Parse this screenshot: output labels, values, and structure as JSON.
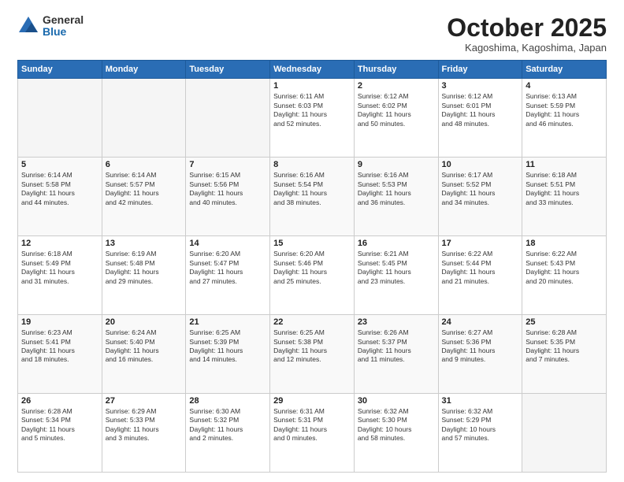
{
  "logo": {
    "general": "General",
    "blue": "Blue"
  },
  "header": {
    "month": "October 2025",
    "location": "Kagoshima, Kagoshima, Japan"
  },
  "weekdays": [
    "Sunday",
    "Monday",
    "Tuesday",
    "Wednesday",
    "Thursday",
    "Friday",
    "Saturday"
  ],
  "weeks": [
    [
      {
        "day": "",
        "info": ""
      },
      {
        "day": "",
        "info": ""
      },
      {
        "day": "",
        "info": ""
      },
      {
        "day": "1",
        "info": "Sunrise: 6:11 AM\nSunset: 6:03 PM\nDaylight: 11 hours\nand 52 minutes."
      },
      {
        "day": "2",
        "info": "Sunrise: 6:12 AM\nSunset: 6:02 PM\nDaylight: 11 hours\nand 50 minutes."
      },
      {
        "day": "3",
        "info": "Sunrise: 6:12 AM\nSunset: 6:01 PM\nDaylight: 11 hours\nand 48 minutes."
      },
      {
        "day": "4",
        "info": "Sunrise: 6:13 AM\nSunset: 5:59 PM\nDaylight: 11 hours\nand 46 minutes."
      }
    ],
    [
      {
        "day": "5",
        "info": "Sunrise: 6:14 AM\nSunset: 5:58 PM\nDaylight: 11 hours\nand 44 minutes."
      },
      {
        "day": "6",
        "info": "Sunrise: 6:14 AM\nSunset: 5:57 PM\nDaylight: 11 hours\nand 42 minutes."
      },
      {
        "day": "7",
        "info": "Sunrise: 6:15 AM\nSunset: 5:56 PM\nDaylight: 11 hours\nand 40 minutes."
      },
      {
        "day": "8",
        "info": "Sunrise: 6:16 AM\nSunset: 5:54 PM\nDaylight: 11 hours\nand 38 minutes."
      },
      {
        "day": "9",
        "info": "Sunrise: 6:16 AM\nSunset: 5:53 PM\nDaylight: 11 hours\nand 36 minutes."
      },
      {
        "day": "10",
        "info": "Sunrise: 6:17 AM\nSunset: 5:52 PM\nDaylight: 11 hours\nand 34 minutes."
      },
      {
        "day": "11",
        "info": "Sunrise: 6:18 AM\nSunset: 5:51 PM\nDaylight: 11 hours\nand 33 minutes."
      }
    ],
    [
      {
        "day": "12",
        "info": "Sunrise: 6:18 AM\nSunset: 5:49 PM\nDaylight: 11 hours\nand 31 minutes."
      },
      {
        "day": "13",
        "info": "Sunrise: 6:19 AM\nSunset: 5:48 PM\nDaylight: 11 hours\nand 29 minutes."
      },
      {
        "day": "14",
        "info": "Sunrise: 6:20 AM\nSunset: 5:47 PM\nDaylight: 11 hours\nand 27 minutes."
      },
      {
        "day": "15",
        "info": "Sunrise: 6:20 AM\nSunset: 5:46 PM\nDaylight: 11 hours\nand 25 minutes."
      },
      {
        "day": "16",
        "info": "Sunrise: 6:21 AM\nSunset: 5:45 PM\nDaylight: 11 hours\nand 23 minutes."
      },
      {
        "day": "17",
        "info": "Sunrise: 6:22 AM\nSunset: 5:44 PM\nDaylight: 11 hours\nand 21 minutes."
      },
      {
        "day": "18",
        "info": "Sunrise: 6:22 AM\nSunset: 5:43 PM\nDaylight: 11 hours\nand 20 minutes."
      }
    ],
    [
      {
        "day": "19",
        "info": "Sunrise: 6:23 AM\nSunset: 5:41 PM\nDaylight: 11 hours\nand 18 minutes."
      },
      {
        "day": "20",
        "info": "Sunrise: 6:24 AM\nSunset: 5:40 PM\nDaylight: 11 hours\nand 16 minutes."
      },
      {
        "day": "21",
        "info": "Sunrise: 6:25 AM\nSunset: 5:39 PM\nDaylight: 11 hours\nand 14 minutes."
      },
      {
        "day": "22",
        "info": "Sunrise: 6:25 AM\nSunset: 5:38 PM\nDaylight: 11 hours\nand 12 minutes."
      },
      {
        "day": "23",
        "info": "Sunrise: 6:26 AM\nSunset: 5:37 PM\nDaylight: 11 hours\nand 11 minutes."
      },
      {
        "day": "24",
        "info": "Sunrise: 6:27 AM\nSunset: 5:36 PM\nDaylight: 11 hours\nand 9 minutes."
      },
      {
        "day": "25",
        "info": "Sunrise: 6:28 AM\nSunset: 5:35 PM\nDaylight: 11 hours\nand 7 minutes."
      }
    ],
    [
      {
        "day": "26",
        "info": "Sunrise: 6:28 AM\nSunset: 5:34 PM\nDaylight: 11 hours\nand 5 minutes."
      },
      {
        "day": "27",
        "info": "Sunrise: 6:29 AM\nSunset: 5:33 PM\nDaylight: 11 hours\nand 3 minutes."
      },
      {
        "day": "28",
        "info": "Sunrise: 6:30 AM\nSunset: 5:32 PM\nDaylight: 11 hours\nand 2 minutes."
      },
      {
        "day": "29",
        "info": "Sunrise: 6:31 AM\nSunset: 5:31 PM\nDaylight: 11 hours\nand 0 minutes."
      },
      {
        "day": "30",
        "info": "Sunrise: 6:32 AM\nSunset: 5:30 PM\nDaylight: 10 hours\nand 58 minutes."
      },
      {
        "day": "31",
        "info": "Sunrise: 6:32 AM\nSunset: 5:29 PM\nDaylight: 10 hours\nand 57 minutes."
      },
      {
        "day": "",
        "info": ""
      }
    ]
  ]
}
